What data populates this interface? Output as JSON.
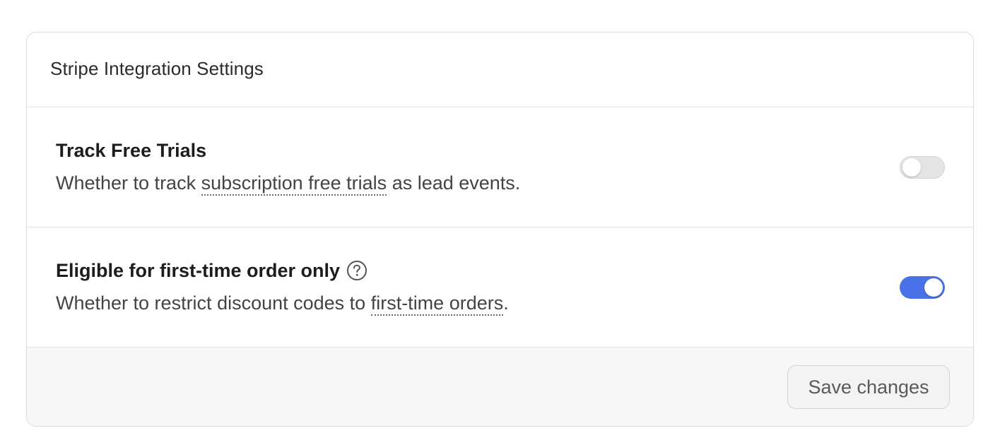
{
  "card": {
    "title": "Stripe Integration Settings"
  },
  "settings": [
    {
      "title": "Track Free Trials",
      "desc_before": "Whether to track ",
      "desc_link": "subscription free trials",
      "desc_after": " as lead events.",
      "enabled": false,
      "has_help_icon": false
    },
    {
      "title": "Eligible for first-time order only",
      "desc_before": "Whether to restrict discount codes to ",
      "desc_link": "first-time orders",
      "desc_after": ".",
      "enabled": true,
      "has_help_icon": true,
      "help_icon": "question-circle-icon"
    }
  ],
  "footer": {
    "save_label": "Save changes"
  },
  "colors": {
    "toggle_on": "#4a72e8",
    "toggle_off": "#e4e4e4",
    "footer_bg": "#f7f7f7",
    "border": "#dcdcdc"
  }
}
